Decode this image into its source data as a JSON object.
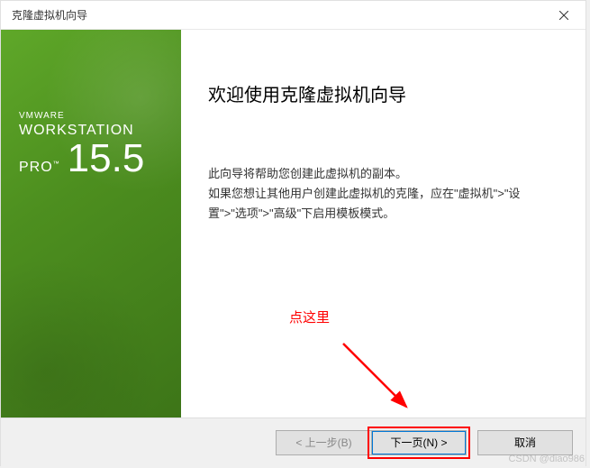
{
  "titlebar": {
    "title": "克隆虚拟机向导"
  },
  "sidebar": {
    "brand1": "VMWARE",
    "brand2": "WORKSTATION",
    "brand3": "PRO",
    "tm": "™",
    "version": "15.5"
  },
  "main": {
    "title": "欢迎使用克隆虚拟机向导",
    "desc": "此向导将帮助您创建此虚拟机的副本。\n如果您想让其他用户创建此虚拟机的克隆，应在\"虚拟机\">\"设置\">\"选项\">\"高级\"下启用模板模式。"
  },
  "annotation": {
    "text": "点这里"
  },
  "footer": {
    "back": "< 上一步(B)",
    "next": "下一页(N) >",
    "cancel": "取消"
  },
  "watermark": "CSDN @diao986"
}
